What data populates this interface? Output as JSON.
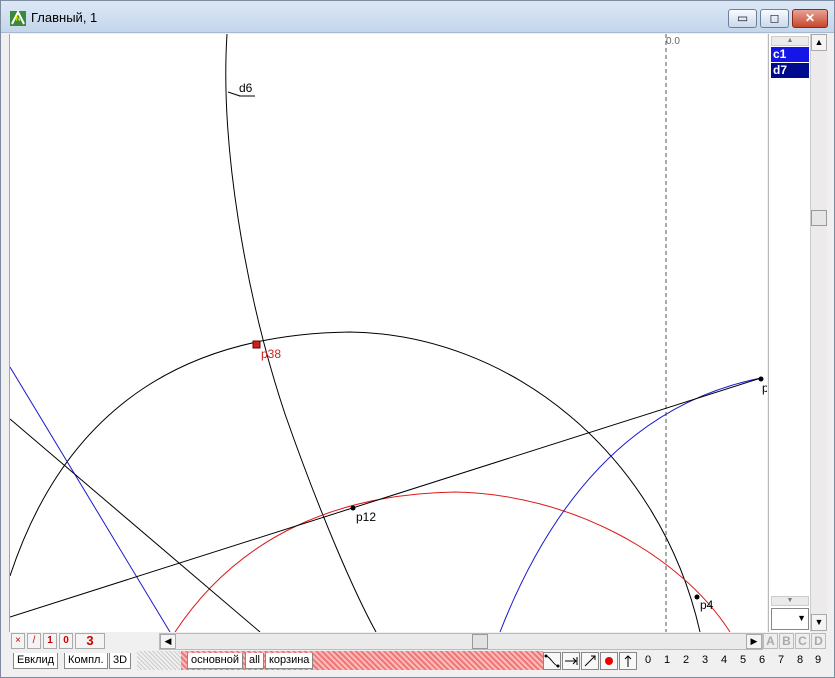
{
  "window": {
    "title": "Главный, 1",
    "minimize": "▭",
    "maximize": "◻",
    "close": "✕"
  },
  "canvas": {
    "axis_label": "0.0",
    "labels": {
      "d6": "d6",
      "p38": "p38",
      "p12": "p12",
      "p4": "p4",
      "p_edge": "p"
    },
    "colors": {
      "black": "#000000",
      "blue": "#1a1acc",
      "red": "#dd1a1a",
      "selected_point": "#cc2020"
    }
  },
  "layers": {
    "items": [
      {
        "label": "c1",
        "color": "#1515e8"
      },
      {
        "label": "d7",
        "color": "#000a8c"
      }
    ]
  },
  "bottom_tools": {
    "left": [
      "×",
      "/",
      "1",
      "0",
      "3"
    ],
    "letters": [
      "A",
      "B",
      "C",
      "D"
    ]
  },
  "tabs": {
    "mode_tabs": [
      "Евклид",
      "Компл.",
      "3D"
    ],
    "layer_tabs": [
      "основной",
      "all",
      "корзина"
    ]
  },
  "numbers": [
    "0",
    "1",
    "2",
    "3",
    "4",
    "5",
    "6",
    "7",
    "8",
    "9"
  ]
}
